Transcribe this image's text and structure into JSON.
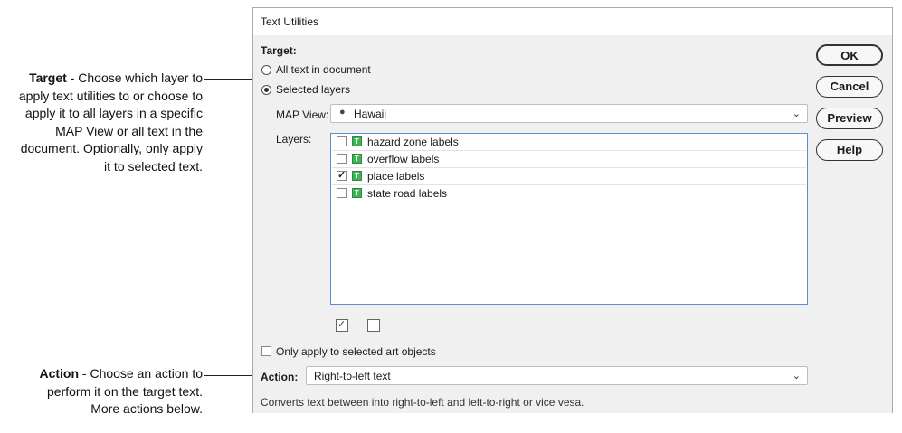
{
  "callouts": {
    "target": {
      "term": "Target",
      "lines": [
        "- Choose which layer to",
        "apply text utilities to or choose to",
        "apply it to all layers in a specific",
        "MAP  View or all text in the",
        "document. Optionally, only apply",
        "it to selected text."
      ]
    },
    "action": {
      "term": "Action",
      "lines": [
        "- Choose an action to",
        "perform it on the target text.",
        "More actions below."
      ]
    }
  },
  "dialog": {
    "title": "Text Utilities",
    "target_label": "Target:",
    "radio_all": "All text in document",
    "radio_selected": "Selected layers",
    "selected_radio": "selected_layers",
    "map_view_label": "MAP View:",
    "map_view_value": "Hawaii",
    "map_view_icon": "globe-icon",
    "layers_label": "Layers:",
    "layers": [
      {
        "label": "hazard zone labels",
        "checked": false,
        "icon": "text-layer-icon"
      },
      {
        "label": "overflow labels",
        "checked": false,
        "icon": "text-layer-icon"
      },
      {
        "label": "place labels",
        "checked": true,
        "icon": "text-layer-icon"
      },
      {
        "label": "state road labels",
        "checked": false,
        "icon": "text-layer-icon"
      }
    ],
    "only_selected_label": "Only apply to selected art objects",
    "only_selected_checked": false,
    "action_label": "Action:",
    "action_value": "Right-to-left text",
    "action_description": "Converts text between into right-to-left and left-to-right or vice vesa.",
    "buttons": {
      "ok": "OK",
      "cancel": "Cancel",
      "preview": "Preview",
      "help": "Help"
    }
  },
  "colors": {
    "list_border": "#5b8fd1",
    "text_icon": "#3fb356",
    "dialog_bg": "#f0f0f0"
  }
}
